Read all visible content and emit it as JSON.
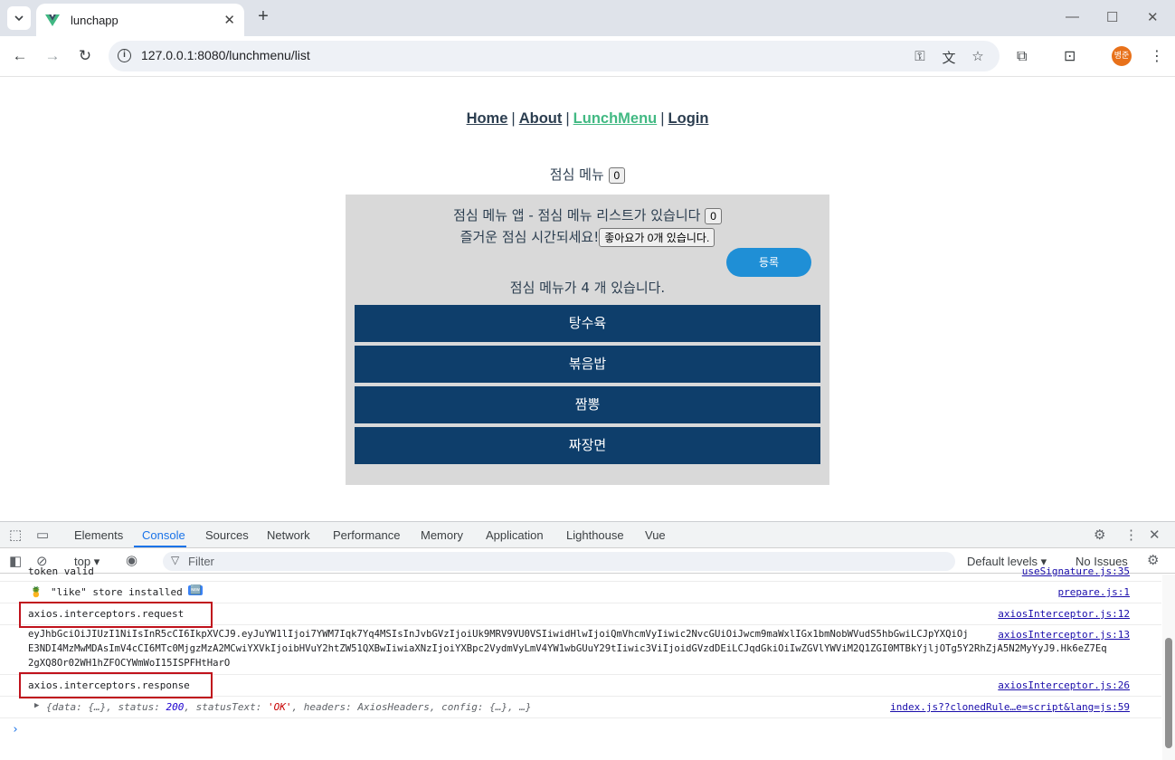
{
  "browser": {
    "tab_title": "lunchapp",
    "url": "127.0.0.1:8080/lunchmenu/list",
    "profile_initials": "병준"
  },
  "page": {
    "nav": [
      {
        "label": "Home",
        "active": false
      },
      {
        "label": "About",
        "active": false
      },
      {
        "label": "LunchMenu",
        "active": true
      },
      {
        "label": "Login",
        "active": false
      }
    ],
    "nav_separator": "|",
    "title": "점심 메뉴",
    "title_count": "0",
    "panel_line1": "점심 메뉴 앱 - 점심 메뉴 리스트가 있습니다",
    "panel_line1_count": "0",
    "panel_line2": "즐거운 점심 시간되세요!",
    "like_button": "좋아요가 0개 있습니다.",
    "register_button": "등록",
    "menu_count_text": "점심 메뉴가 4 개 있습니다.",
    "menu_items": [
      "탕수육",
      "볶음밥",
      "짬뽕",
      "짜장면"
    ],
    "accent_color": "#42b983",
    "menu_item_color": "#0e3e6b"
  },
  "devtools": {
    "tabs": [
      "Elements",
      "Console",
      "Sources",
      "Network",
      "Performance",
      "Memory",
      "Application",
      "Lighthouse",
      "Vue"
    ],
    "active_tab": "Console",
    "context": "top",
    "filter_placeholder": "Filter",
    "levels": "Default levels",
    "issues": "No Issues",
    "console_lines": [
      {
        "msg": "token valid",
        "src": "useSignature.js:35"
      },
      {
        "msg": "\"like\" store installed",
        "badge": "🆕",
        "src": "prepare.js:1"
      },
      {
        "msg": "axios.interceptors.request",
        "src": "axiosInterceptor.js:12"
      },
      {
        "msg": "eyJhbGciOiJIUzI1NiIsInR5cCI6IkpXVCJ9.eyJuYW1lIjoi7YWM7Iqk7Yq4MSIsInJvbGVzIjoiUk9MRV9VU0VSIiwidHlwIjoiQmVhcmVyIiwic2NvcGUiOiJwcm9maWxlIGx1bmNobWVudS5hbGwiLCJpYXQiOj",
        "msg2": "E3NDI4MzMwMDAsImV4cCI6MTc0MjgzMzA2MCwiYXVkIjoibHVuY2htZW51QXBwIiwiaXNzIjoiYXBpc2VydmVyLmV4YW1wbGUuY29tIiwic3ViIjoidGVzdDEiLCJqdGkiOiIwZGVlYWViM2Q1ZGI0MTBkYjljOTg5Y2RhZjA5N2MyYyJ9.Hk6eZ7Eq",
        "msg3": "2gXQ8Or02WH1hZFOCYWmWoI15ISPFHtHarO",
        "src": "axiosInterceptor.js:13"
      },
      {
        "msg": "axios.interceptors.response",
        "src": "axiosInterceptor.js:26"
      },
      {
        "msg_obj_prefix": "{data: {…}, status: ",
        "status": "200",
        "status_text_key": ", statusText: ",
        "status_text": "'OK'",
        "rest": ", headers: AxiosHeaders, config: {…}, …}",
        "src": "index.js??clonedRule…e=script&lang=js:59"
      }
    ]
  }
}
